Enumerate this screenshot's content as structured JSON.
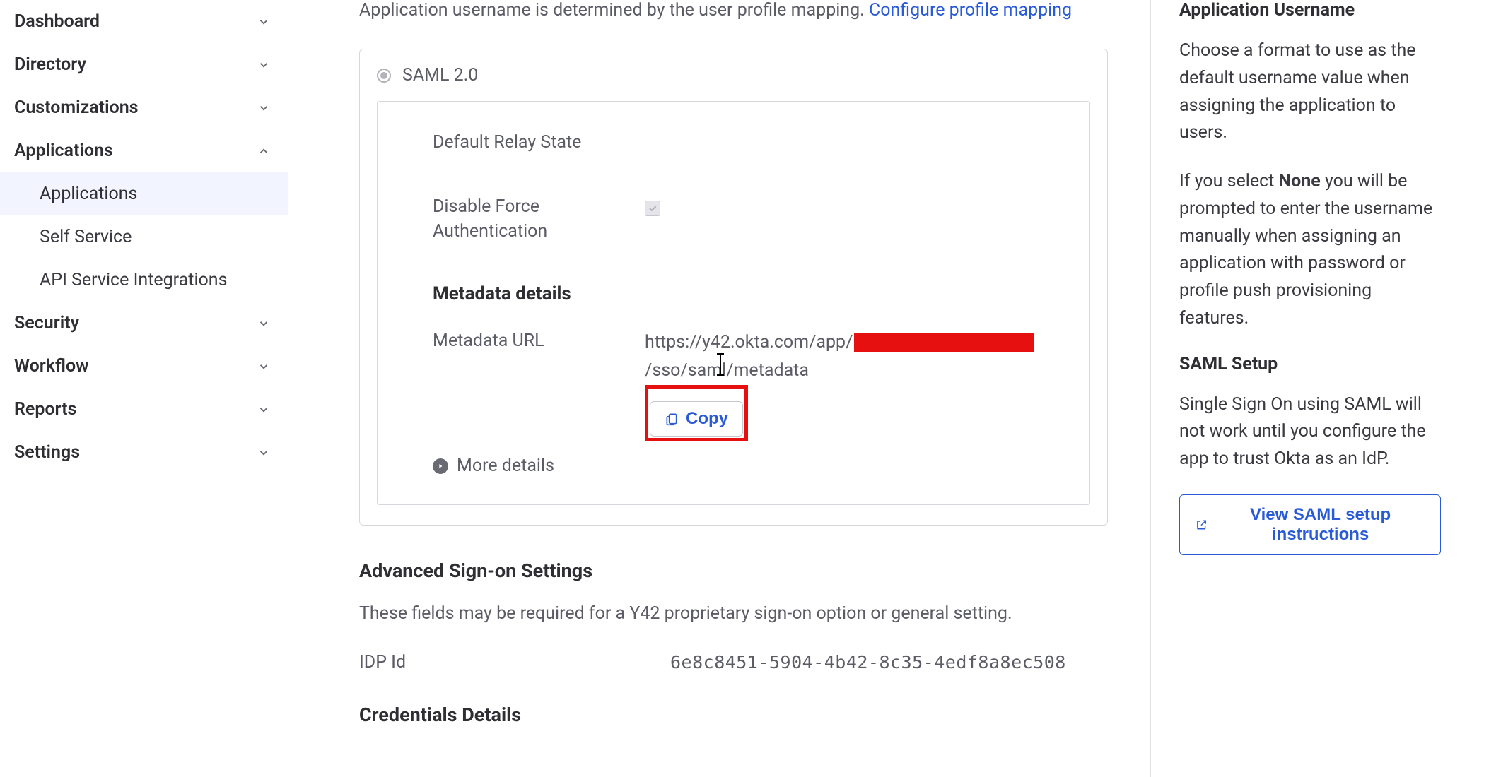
{
  "sidebar": {
    "items": [
      {
        "label": "Dashboard",
        "expanded": false
      },
      {
        "label": "Directory",
        "expanded": false
      },
      {
        "label": "Customizations",
        "expanded": false
      },
      {
        "label": "Applications",
        "expanded": true,
        "children": [
          {
            "label": "Applications",
            "active": true
          },
          {
            "label": "Self Service"
          },
          {
            "label": "API Service Integrations"
          }
        ]
      },
      {
        "label": "Security",
        "expanded": false
      },
      {
        "label": "Workflow",
        "expanded": false
      },
      {
        "label": "Reports",
        "expanded": false
      },
      {
        "label": "Settings",
        "expanded": false
      }
    ]
  },
  "main": {
    "intro_text": "Application username is determined by the user profile mapping. ",
    "intro_link": "Configure profile mapping",
    "saml_label": "SAML 2.0",
    "default_relay_label": "Default Relay State",
    "disable_force_label": "Disable Force Authentication",
    "metadata_head": "Metadata details",
    "metadata_url_label": "Metadata URL",
    "metadata_url_pre": "https://y42.okta.com/app/",
    "metadata_url_post": "/sso/saml/metadata",
    "copy_label": "Copy",
    "more_details": "More details",
    "advanced_head": "Advanced Sign-on Settings",
    "advanced_desc": "These fields may be required for a Y42 proprietary sign-on option or general setting.",
    "idp_label": "IDP Id",
    "idp_val": "6e8c8451-5904-4b42-8c35-4edf8a8ec508",
    "credentials_head": "Credentials Details"
  },
  "right": {
    "app_user_head": "Application Username",
    "app_user_p1": "Choose a format to use as the default username value when assigning the application to users.",
    "app_user_p2_a": "If you select ",
    "app_user_p2_b": "None",
    "app_user_p2_c": " you will be prompted to enter the username manually when assigning an application with password or profile push provisioning features.",
    "saml_setup_head": "SAML Setup",
    "saml_setup_p": "Single Sign On using SAML will not work until you configure the app to trust Okta as an IdP.",
    "view_saml_label": "View SAML setup instructions"
  }
}
